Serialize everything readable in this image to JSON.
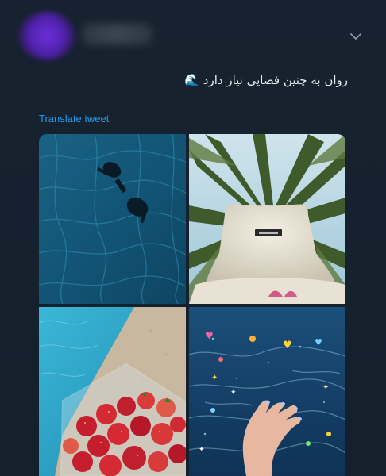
{
  "tweet": {
    "text": "روان به چنین فضایی نیاز دارد 🌊",
    "translate_label": "Translate tweet"
  },
  "media": {
    "images": [
      {
        "icon": "pool-sunglasses-image"
      },
      {
        "icon": "bucket-hat-palm-image"
      },
      {
        "icon": "strawberries-pool-image"
      },
      {
        "icon": "hand-in-water-image"
      }
    ]
  },
  "colors": {
    "background": "#15202b",
    "link": "#1d9bf0",
    "text": "#e9eef2"
  }
}
